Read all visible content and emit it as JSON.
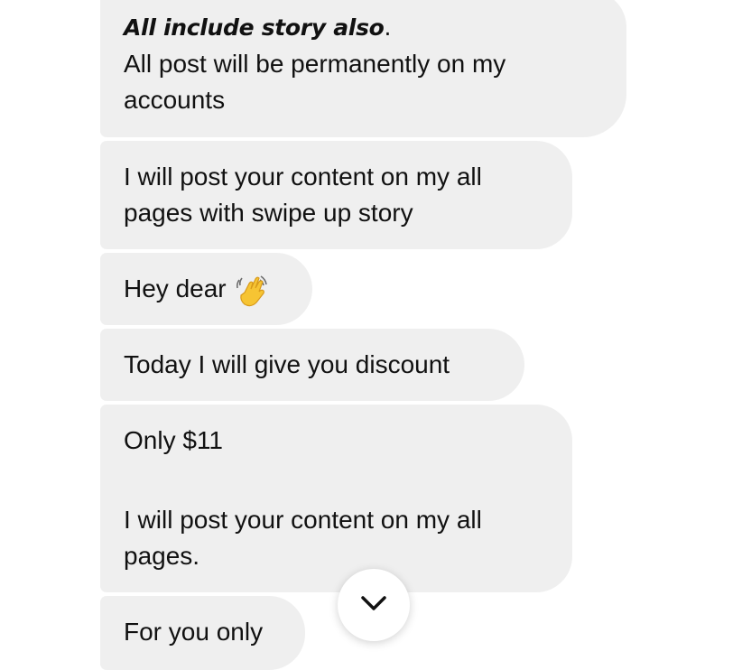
{
  "messages": [
    {
      "line_bold_italic": "All include story also",
      "line_bold_suffix": ".",
      "line2": " All post will be permanently on my",
      "line3": "accounts"
    },
    {
      "line1": "I will post your content on my all",
      "line2": "pages with swipe up story"
    },
    {
      "text": "Hey dear",
      "emoji": "waving-hand-icon"
    },
    {
      "text": "Today I will give you discount"
    },
    {
      "line1": "Only $11",
      "line2": "I will post your content on my all",
      "line3": "pages."
    },
    {
      "text": "For you only"
    }
  ],
  "scroll_button": {
    "icon": "chevron-down-icon"
  },
  "colors": {
    "bubble": "#efefef",
    "text": "#111111",
    "background": "#ffffff",
    "emoji": "#f6c433"
  }
}
